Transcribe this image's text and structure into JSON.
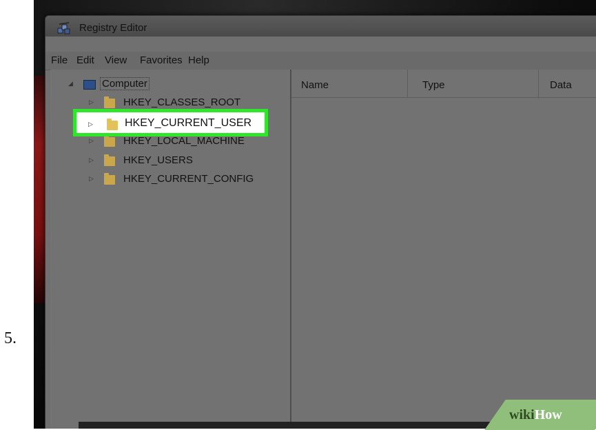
{
  "step_number": "5.",
  "window": {
    "title": "Registry Editor"
  },
  "menu": [
    "File",
    "Edit",
    "View",
    "Favorites",
    "Help"
  ],
  "tree": {
    "root": "Computer",
    "children": [
      "HKEY_CLASSES_ROOT",
      "HKEY_CURRENT_USER",
      "HKEY_LOCAL_MACHINE",
      "HKEY_USERS",
      "HKEY_CURRENT_CONFIG"
    ],
    "highlighted": "HKEY_CURRENT_USER",
    "highlight_color": "#2fe62b"
  },
  "columns": [
    "Name",
    "Type",
    "Data"
  ],
  "watermark": {
    "part1": "wiki",
    "part2": "How"
  }
}
